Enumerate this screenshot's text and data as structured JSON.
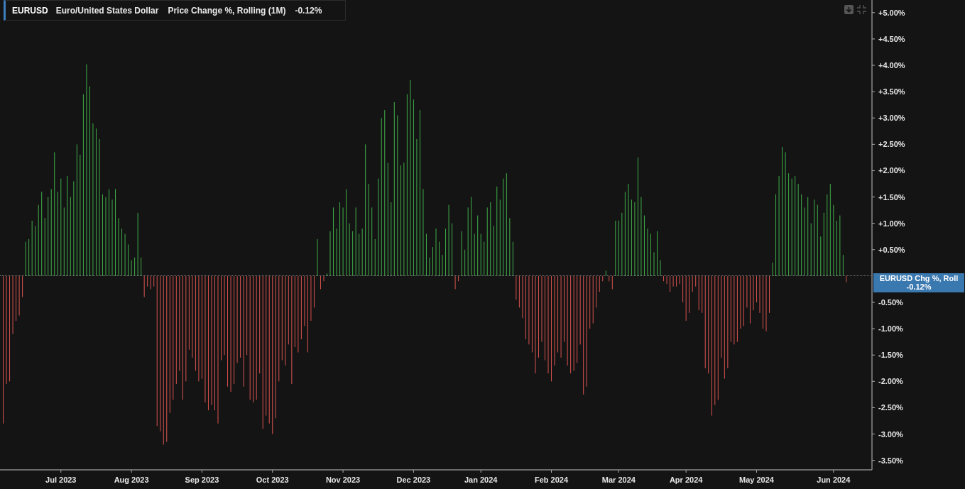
{
  "legend": {
    "symbol": "EURUSD",
    "name": "Euro/United States Dollar",
    "study": "Price Change %, Rolling (1M)",
    "value": "-0.12%"
  },
  "badge": {
    "label": "EURUSD Chg %, Roll",
    "value": "-0.12%"
  },
  "chart_data": {
    "type": "bar",
    "ylim": [
      -3.68,
      5.24
    ],
    "categories": [
      null,
      null,
      null,
      null,
      null,
      null,
      null,
      null,
      null,
      null,
      null,
      null,
      null,
      null,
      null,
      null,
      null,
      null,
      "Jul 2023",
      null,
      null,
      null,
      null,
      null,
      null,
      null,
      null,
      null,
      null,
      null,
      null,
      null,
      null,
      null,
      null,
      null,
      null,
      null,
      null,
      null,
      "Aug 2023",
      null,
      null,
      null,
      null,
      null,
      null,
      null,
      null,
      null,
      null,
      null,
      null,
      null,
      null,
      null,
      null,
      null,
      null,
      null,
      null,
      null,
      "Sep 2023",
      null,
      null,
      null,
      null,
      null,
      null,
      null,
      null,
      null,
      null,
      null,
      null,
      null,
      null,
      null,
      null,
      null,
      null,
      null,
      null,
      null,
      "Oct 2023",
      null,
      null,
      null,
      null,
      null,
      null,
      null,
      null,
      null,
      null,
      null,
      null,
      null,
      null,
      null,
      null,
      null,
      null,
      null,
      null,
      null,
      "Nov 2023",
      null,
      null,
      null,
      null,
      null,
      null,
      null,
      null,
      null,
      null,
      null,
      null,
      null,
      null,
      null,
      null,
      null,
      null,
      null,
      null,
      null,
      "Dec 2023",
      null,
      null,
      null,
      null,
      null,
      null,
      null,
      null,
      null,
      null,
      null,
      null,
      null,
      null,
      null,
      null,
      null,
      null,
      null,
      null,
      "Jan 2024",
      null,
      null,
      null,
      null,
      null,
      null,
      null,
      null,
      null,
      null,
      null,
      null,
      null,
      null,
      null,
      null,
      null,
      null,
      null,
      null,
      null,
      "Feb 2024",
      null,
      null,
      null,
      null,
      null,
      null,
      null,
      null,
      null,
      null,
      null,
      null,
      null,
      null,
      null,
      null,
      null,
      null,
      null,
      null,
      "Mar 2024",
      null,
      null,
      null,
      null,
      null,
      null,
      null,
      null,
      null,
      null,
      null,
      null,
      null,
      null,
      null,
      null,
      null,
      null,
      null,
      null,
      "Apr 2024",
      null,
      null,
      null,
      null,
      null,
      null,
      null,
      null,
      null,
      null,
      null,
      null,
      null,
      null,
      null,
      null,
      null,
      null,
      null,
      null,
      null,
      "May 2024",
      null,
      null,
      null,
      null,
      null,
      null,
      null,
      null,
      null,
      null,
      null,
      null,
      null,
      null,
      null,
      null,
      null,
      null,
      null,
      null,
      null,
      null,
      null,
      "Jun 2024",
      null,
      null,
      null,
      null
    ],
    "series": [
      {
        "color": "#3fae49",
        "values": [
          null,
          null,
          null,
          null,
          null,
          null,
          null,
          0.65,
          0.7,
          1.05,
          0.95,
          1.35,
          1.6,
          1.1,
          1.5,
          1.65,
          2.35,
          1.6,
          1.85,
          1.3,
          1.9,
          1.5,
          1.8,
          2.5,
          2.3,
          3.45,
          4.02,
          3.6,
          2.9,
          2.8,
          2.6,
          1.55,
          1.5,
          1.65,
          1.45,
          1.65,
          1.1,
          0.9,
          0.8,
          0.6,
          0.3,
          0.35,
          1.2,
          0.35,
          null,
          null,
          null,
          null,
          null,
          null,
          null,
          null,
          null,
          null,
          null,
          null,
          null,
          null,
          null,
          null,
          null,
          null,
          null,
          null,
          null,
          null,
          null,
          null,
          null,
          null,
          null,
          null,
          null,
          null,
          null,
          null,
          null,
          null,
          null,
          null,
          null,
          null,
          null,
          null,
          null,
          null,
          null,
          null,
          null,
          null,
          null,
          null,
          null,
          null,
          null,
          null,
          null,
          null,
          0.7,
          null,
          null,
          0.05,
          0.85,
          1.3,
          0.9,
          1.4,
          1.3,
          1.65,
          1.0,
          0.85,
          1.3,
          0.8,
          0.9,
          2.5,
          1.75,
          1.3,
          0.7,
          1.85,
          3.0,
          3.15,
          2.15,
          1.4,
          3.3,
          3.05,
          2.1,
          2.15,
          3.45,
          3.72,
          3.35,
          2.6,
          3.15,
          1.65,
          0.8,
          0.35,
          0.55,
          0.9,
          0.65,
          0.4,
          0.9,
          1.35,
          1.0,
          null,
          null,
          0.85,
          0.5,
          1.3,
          1.5,
          0.8,
          1.15,
          0.8,
          0.65,
          1.3,
          1.4,
          0.95,
          1.7,
          1.45,
          1.85,
          1.95,
          1.1,
          0.65,
          null,
          null,
          null,
          null,
          null,
          null,
          null,
          null,
          null,
          null,
          null,
          null,
          null,
          null,
          null,
          null,
          null,
          null,
          null,
          null,
          null,
          null,
          null,
          null,
          null,
          null,
          null,
          null,
          0.1,
          null,
          null,
          1.05,
          1.05,
          1.2,
          1.6,
          1.75,
          1.45,
          1.4,
          2.25,
          1.5,
          1.15,
          0.9,
          0.8,
          0.45,
          0.85,
          0.3,
          null,
          null,
          null,
          null,
          null,
          null,
          null,
          null,
          null,
          null,
          null,
          null,
          null,
          null,
          null,
          null,
          null,
          null,
          null,
          null,
          null,
          null,
          null,
          null,
          null,
          null,
          null,
          null,
          null,
          null,
          null,
          null,
          null,
          null,
          0.25,
          1.55,
          1.9,
          2.45,
          2.35,
          1.95,
          1.85,
          1.9,
          1.75,
          1.55,
          1.3,
          1.5,
          1.0,
          1.45,
          1.35,
          0.75,
          1.2,
          1.55,
          1.75,
          1.35,
          1.05,
          1.15,
          0.4,
          null
        ]
      },
      {
        "color": "#d9534f",
        "values": [
          -2.8,
          -2.05,
          -2.0,
          -1.1,
          -0.85,
          -0.75,
          -0.4,
          null,
          null,
          null,
          null,
          null,
          null,
          null,
          null,
          null,
          null,
          null,
          null,
          null,
          null,
          null,
          null,
          null,
          null,
          null,
          null,
          null,
          null,
          null,
          null,
          null,
          null,
          null,
          null,
          null,
          null,
          null,
          null,
          null,
          null,
          null,
          null,
          null,
          -0.4,
          -0.2,
          -0.25,
          -0.2,
          -2.85,
          -2.95,
          -3.2,
          -3.15,
          -2.6,
          -2.35,
          -2.05,
          -1.8,
          -2.35,
          -2.0,
          -1.4,
          -1.55,
          -1.8,
          -2.0,
          -1.95,
          -2.4,
          -2.55,
          -2.45,
          -2.55,
          -2.8,
          -1.6,
          -1.5,
          -2.1,
          -2.2,
          -2.05,
          -1.65,
          -1.55,
          -2.1,
          -1.5,
          -2.35,
          -2.4,
          -2.35,
          -1.85,
          -2.9,
          -2.65,
          -2.8,
          -3.0,
          -2.7,
          -2.0,
          -1.6,
          -1.7,
          -1.3,
          -2.05,
          -1.35,
          -1.45,
          -1.2,
          -0.95,
          -1.45,
          -0.85,
          -0.6,
          null,
          -0.25,
          -0.1,
          null,
          null,
          null,
          null,
          null,
          null,
          null,
          null,
          null,
          null,
          null,
          null,
          null,
          null,
          null,
          null,
          null,
          null,
          null,
          null,
          null,
          null,
          null,
          null,
          null,
          null,
          null,
          null,
          null,
          null,
          null,
          null,
          null,
          null,
          null,
          null,
          null,
          null,
          null,
          null,
          -0.25,
          -0.1,
          null,
          null,
          null,
          null,
          null,
          null,
          null,
          null,
          null,
          null,
          null,
          null,
          null,
          null,
          null,
          null,
          null,
          -0.45,
          -0.6,
          -0.8,
          -1.2,
          -1.3,
          -1.45,
          -1.85,
          -1.55,
          -1.25,
          -1.6,
          -1.85,
          -2.0,
          -1.7,
          -1.45,
          -1.55,
          -1.25,
          -1.7,
          -1.85,
          -1.8,
          -1.65,
          -1.3,
          -2.25,
          -2.1,
          -1.0,
          -0.9,
          -0.6,
          -0.3,
          -0.1,
          null,
          -0.1,
          -0.25,
          null,
          null,
          null,
          null,
          null,
          null,
          null,
          null,
          null,
          null,
          null,
          null,
          null,
          null,
          null,
          -0.1,
          -0.15,
          -0.3,
          -0.2,
          -0.2,
          -0.15,
          -0.5,
          -0.85,
          -0.7,
          -0.3,
          -0.2,
          -0.65,
          -0.7,
          -1.75,
          -1.85,
          -2.65,
          -2.45,
          -2.35,
          -1.55,
          -1.95,
          -1.75,
          -1.25,
          -1.3,
          -1.25,
          -1.0,
          -0.95,
          -0.6,
          -0.9,
          -0.65,
          -0.5,
          -0.7,
          -1.0,
          -1.05,
          -0.7,
          null,
          null,
          null,
          null,
          null,
          null,
          null,
          null,
          null,
          null,
          null,
          null,
          null,
          null,
          null,
          null,
          null,
          null,
          null,
          null,
          null,
          null,
          null,
          -0.12
        ]
      }
    ],
    "yticks": [
      {
        "value": 5,
        "label": "+5.00%"
      },
      {
        "value": 4.5,
        "label": "+4.50%"
      },
      {
        "value": 4,
        "label": "+4.00%"
      },
      {
        "value": 3.5,
        "label": "+3.50%"
      },
      {
        "value": 3,
        "label": "+3.00%"
      },
      {
        "value": 2.5,
        "label": "+2.50%"
      },
      {
        "value": 2,
        "label": "+2.00%"
      },
      {
        "value": 1.5,
        "label": "+1.50%"
      },
      {
        "value": 1,
        "label": "+1.00%"
      },
      {
        "value": 0.5,
        "label": "+0.50%"
      },
      {
        "value": -0.5,
        "label": "-0.50%"
      },
      {
        "value": -1,
        "label": "-1.00%"
      },
      {
        "value": -1.5,
        "label": "-1.50%"
      },
      {
        "value": -2,
        "label": "-2.00%"
      },
      {
        "value": -2.5,
        "label": "-2.50%"
      },
      {
        "value": -3,
        "label": "-3.00%"
      },
      {
        "value": -3.5,
        "label": "-3.50%"
      }
    ]
  }
}
